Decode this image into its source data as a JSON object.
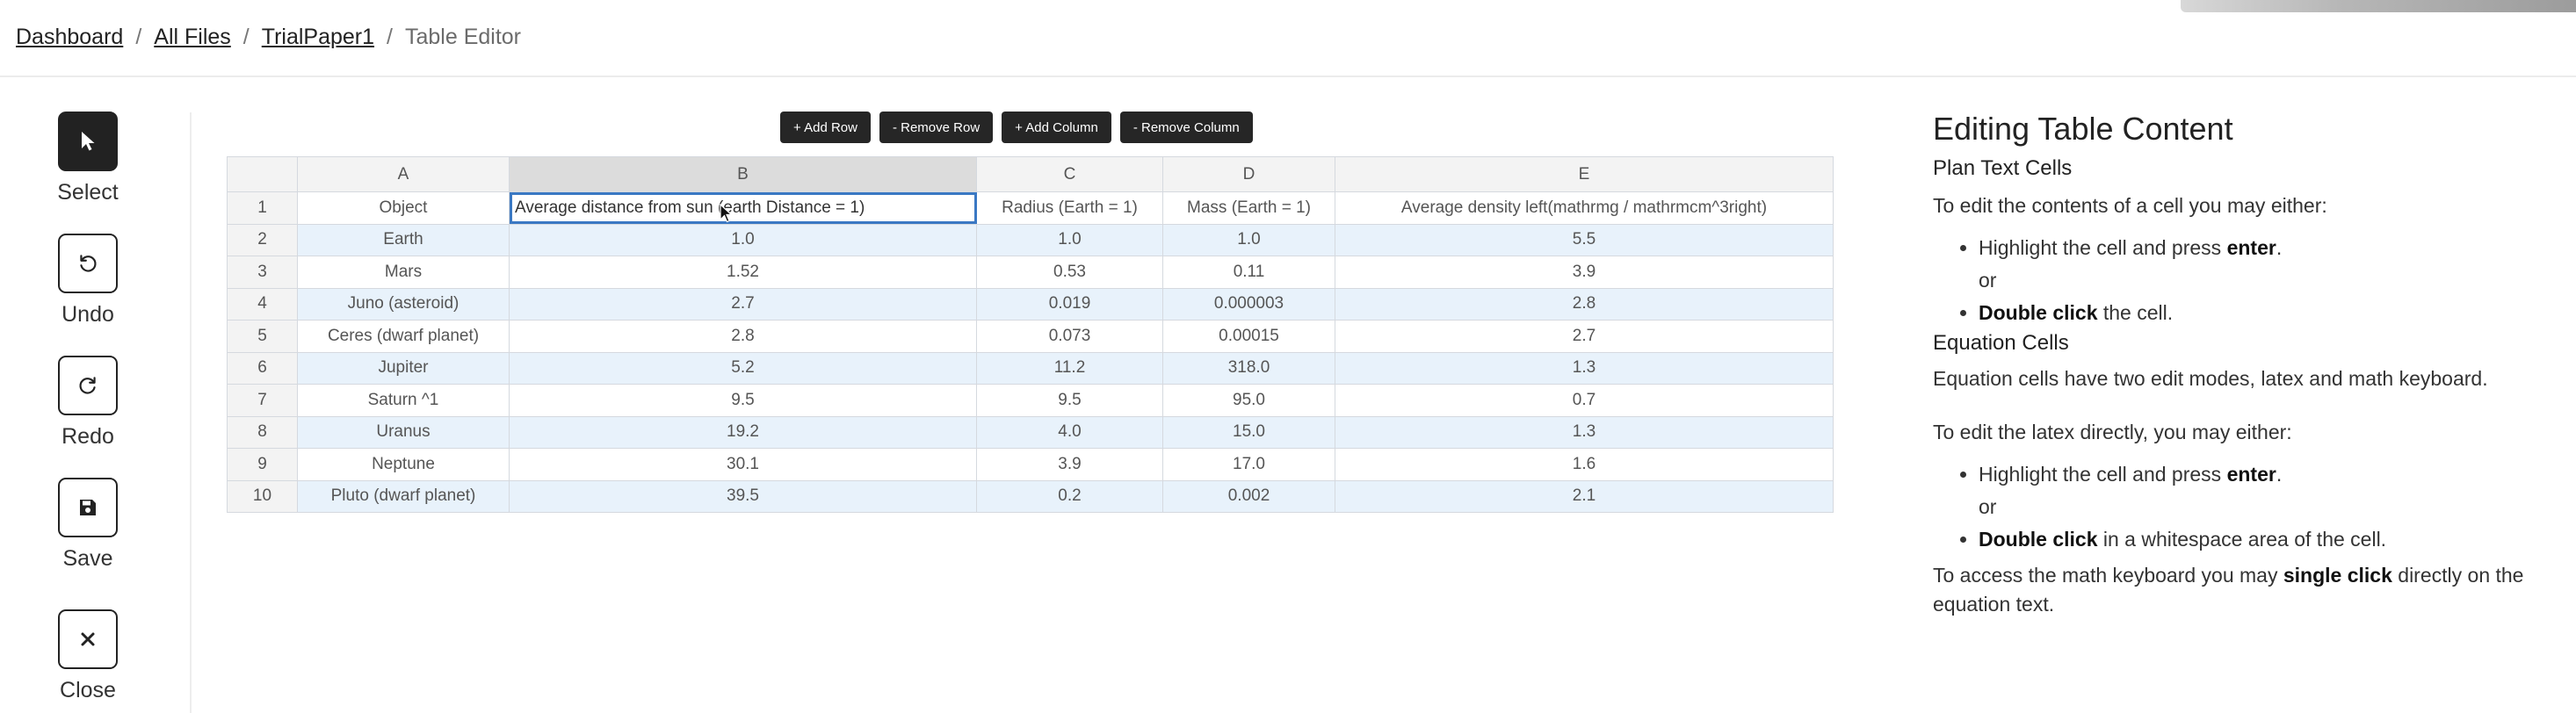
{
  "breadcrumb": {
    "items": [
      "Dashboard",
      "All Files",
      "TrialPaper1"
    ],
    "separator": "/",
    "current": "Table Editor"
  },
  "toolbar": {
    "tools": [
      {
        "label": "Select",
        "icon": "cursor-arrow-icon",
        "active": true
      },
      {
        "label": "Undo",
        "icon": "undo-icon"
      },
      {
        "label": "Redo",
        "icon": "redo-icon"
      },
      {
        "label": "Save",
        "icon": "save-floppy-icon"
      },
      {
        "label": "Close",
        "icon": "close-x-icon"
      }
    ]
  },
  "actions": {
    "add_row": "+ Add Row",
    "remove_row": "- Remove Row",
    "add_column": "+ Add Column",
    "remove_column": "- Remove Column"
  },
  "table": {
    "column_headers": [
      "A",
      "B",
      "C",
      "D",
      "E"
    ],
    "selected_column": "B",
    "selected_cell": "B1",
    "rows": [
      {
        "n": "1",
        "cells": [
          "Object",
          "Average distance from sun (earth Distance = 1)",
          "Radius (Earth = 1)",
          "Mass (Earth = 1)",
          "Average density left(mathrmg / mathrmcm^3right)"
        ]
      },
      {
        "n": "2",
        "cells": [
          "Earth",
          "1.0",
          "1.0",
          "1.0",
          "5.5"
        ]
      },
      {
        "n": "3",
        "cells": [
          "Mars",
          "1.52",
          "0.53",
          "0.11",
          "3.9"
        ]
      },
      {
        "n": "4",
        "cells": [
          "Juno (asteroid)",
          "2.7",
          "0.019",
          "0.000003",
          "2.8"
        ]
      },
      {
        "n": "5",
        "cells": [
          "Ceres (dwarf planet)",
          "2.8",
          "0.073",
          "0.00015",
          "2.7"
        ]
      },
      {
        "n": "6",
        "cells": [
          "Jupiter",
          "5.2",
          "11.2",
          "318.0",
          "1.3"
        ]
      },
      {
        "n": "7",
        "cells": [
          "Saturn ^1",
          "9.5",
          "9.5",
          "95.0",
          "0.7"
        ]
      },
      {
        "n": "8",
        "cells": [
          "Uranus",
          "19.2",
          "4.0",
          "15.0",
          "1.3"
        ]
      },
      {
        "n": "9",
        "cells": [
          "Neptune",
          "30.1",
          "3.9",
          "17.0",
          "1.6"
        ]
      },
      {
        "n": "10",
        "cells": [
          "Pluto (dwarf planet)",
          "39.5",
          "0.2",
          "0.002",
          "2.1"
        ]
      }
    ]
  },
  "help": {
    "title": "Editing Table Content",
    "plain_heading": "Plan Text Cells",
    "plain_intro": "To edit the contents of a cell you may either:",
    "plain_item1_pre": "Highlight the cell and press ",
    "plain_item1_bold": "enter",
    "plain_item1_post": ".",
    "or": "or",
    "plain_item2_bold": "Double click",
    "plain_item2_post": " the cell.",
    "eq_heading": "Equation Cells",
    "eq_intro": "Equation cells have two edit modes, latex and math keyboard.",
    "eq_latex": "To edit the latex directly, you may either:",
    "eq_item1_pre": "Highlight the cell and press ",
    "eq_item1_bold": "enter",
    "eq_item1_post": ".",
    "eq_item2_bold": "Double click",
    "eq_item2_post": " in a whitespace area of the cell.",
    "kb_pre": "To access the math keyboard you may ",
    "kb_bold": "single click",
    "kb_post": " directly on the equation text."
  }
}
